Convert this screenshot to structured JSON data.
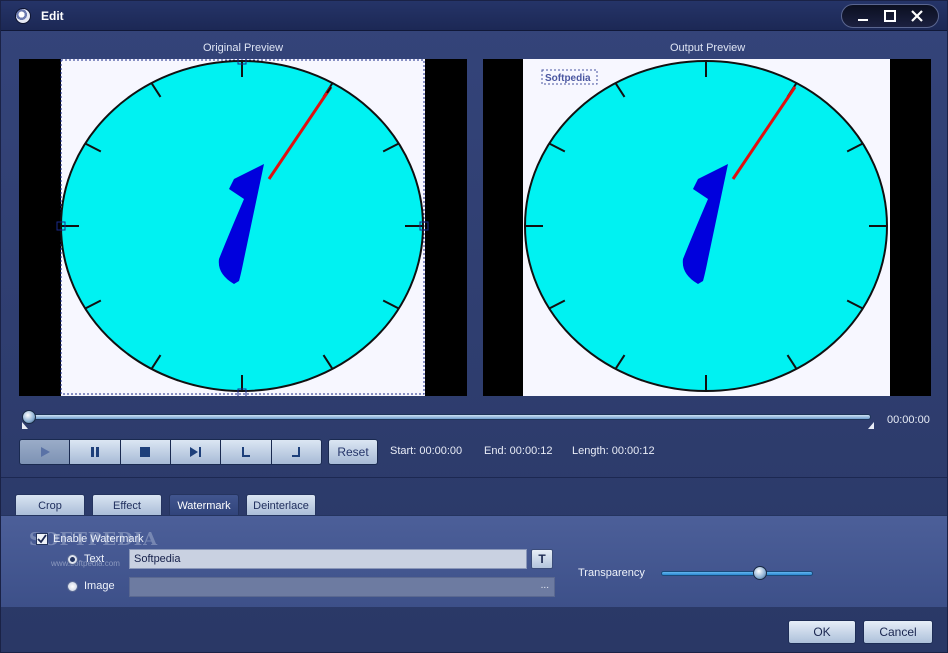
{
  "window": {
    "title": "Edit"
  },
  "previews": {
    "original_label": "Original Preview",
    "output_label": "Output Preview",
    "output_watermark_text": "Softpedia"
  },
  "timeline": {
    "position_fraction": 0.0,
    "current_time": "00:00:00"
  },
  "transport": {
    "reset_label": "Reset",
    "start": "Start: 00:00:00",
    "end": "End: 00:00:12",
    "length": "Length: 00:00:12"
  },
  "tabs": [
    {
      "label": "Crop"
    },
    {
      "label": "Effect"
    },
    {
      "label": "Watermark",
      "active": true
    },
    {
      "label": "Deinterlace"
    }
  ],
  "watermark": {
    "enable_label": "Enable Watermark",
    "enabled": true,
    "text_option_label": "Text",
    "image_option_label": "Image",
    "text_value": "Softpedia",
    "font_button_label": "T",
    "image_browse_label": "...",
    "transparency_label": "Transparency",
    "transparency_fraction": 0.65
  },
  "background_watermark": {
    "brand": "SOFTPEDIA",
    "url": "www.softpedia.com"
  },
  "buttons": {
    "ok": "OK",
    "cancel": "Cancel"
  },
  "colors": {
    "clock_face": "#00f2f2",
    "clock_hand": "#e01010",
    "numeral": "#0000dd"
  }
}
